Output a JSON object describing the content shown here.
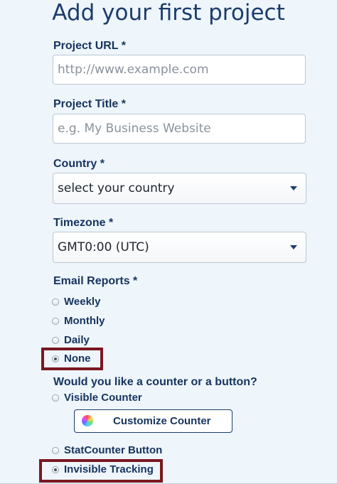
{
  "page": {
    "title": "Add your first project"
  },
  "form": {
    "project_url": {
      "label": "Project URL *",
      "placeholder": "http://www.example.com"
    },
    "project_title": {
      "label": "Project Title *",
      "placeholder": "e.g. My Business Website"
    },
    "country": {
      "label": "Country *",
      "selected": "select your country"
    },
    "timezone": {
      "label": "Timezone *",
      "selected": "GMT0:00 (UTC)"
    },
    "email_reports": {
      "label": "Email Reports *",
      "options": [
        {
          "label": "Weekly",
          "checked": false
        },
        {
          "label": "Monthly",
          "checked": false
        },
        {
          "label": "Daily",
          "checked": false
        },
        {
          "label": "None",
          "checked": true
        }
      ]
    },
    "counter": {
      "label": "Would you like a counter or a button?",
      "options": [
        {
          "label": "Visible Counter",
          "checked": false
        },
        {
          "label": "StatCounter Button",
          "checked": false
        },
        {
          "label": "Invisible Tracking",
          "checked": true
        }
      ],
      "customize_button": {
        "label": "Customize Counter",
        "icon": "color-wheel-icon"
      }
    }
  },
  "colors": {
    "background": "#eef5fb",
    "text": "#16345e",
    "highlight": "#7a1820"
  }
}
